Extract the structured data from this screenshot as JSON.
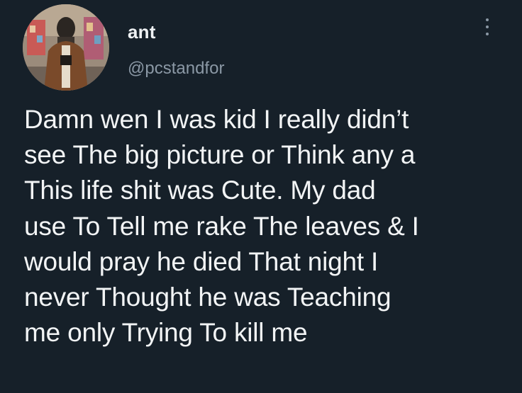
{
  "tweet": {
    "display_name": "ant",
    "handle": "@pcstandfor",
    "more_icon": "more-vertical-icon",
    "avatar_icon": "user-avatar-photo",
    "text_lines": [
      "Damn wen I was kid I really didn’t",
      "see The big picture or Think any a",
      "This life shit was Cute. My dad",
      "use To Tell me rake The leaves & I",
      "would pray he died That night I",
      "never Thought he was Teaching",
      "me only Trying To kill me"
    ]
  },
  "colors": {
    "background": "#162029",
    "text": "#f2f4f5",
    "secondary_text": "#8b98a5"
  }
}
